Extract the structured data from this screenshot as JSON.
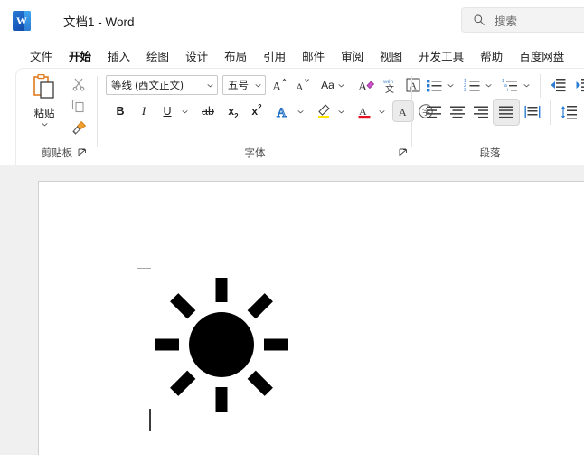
{
  "titlebar": {
    "app_icon": "word-icon",
    "document_title": "文档1  -  Word",
    "search": {
      "placeholder": "搜索",
      "icon": "search-icon"
    }
  },
  "tabs": [
    {
      "id": "file",
      "label": "文件",
      "active": false
    },
    {
      "id": "home",
      "label": "开始",
      "active": true
    },
    {
      "id": "insert",
      "label": "插入",
      "active": false
    },
    {
      "id": "draw",
      "label": "绘图",
      "active": false
    },
    {
      "id": "design",
      "label": "设计",
      "active": false
    },
    {
      "id": "layout",
      "label": "布局",
      "active": false
    },
    {
      "id": "references",
      "label": "引用",
      "active": false
    },
    {
      "id": "mailings",
      "label": "邮件",
      "active": false
    },
    {
      "id": "review",
      "label": "审阅",
      "active": false
    },
    {
      "id": "view",
      "label": "视图",
      "active": false
    },
    {
      "id": "developer",
      "label": "开发工具",
      "active": false
    },
    {
      "id": "help",
      "label": "帮助",
      "active": false
    },
    {
      "id": "baidu",
      "label": "百度网盘",
      "active": false
    }
  ],
  "ribbon": {
    "clipboard": {
      "label": "剪贴板",
      "paste_label": "粘贴",
      "paste_icon": "paste-clipboard-icon",
      "cut_icon": "scissors-icon",
      "copy_icon": "copy-icon",
      "format_painter_icon": "format-painter-icon",
      "dialog_launcher_icon": "dialog-launcher-icon"
    },
    "font": {
      "label": "字体",
      "font_name": "等线 (西文正文)",
      "font_size": "五号",
      "grow_font_icon": "grow-font-icon",
      "shrink_font_icon": "shrink-font-icon",
      "change_case_label": "Aa",
      "clear_formatting_icon": "clear-formatting-icon",
      "phonetic_guide_icon": "phonetic-guide-icon",
      "character_border_icon": "character-border-icon",
      "bold_label": "B",
      "italic_label": "I",
      "underline_label": "U",
      "strikethrough_label": "ab",
      "subscript_label": "x",
      "subscript_sub": "2",
      "superscript_label": "x",
      "superscript_sup": "2",
      "text_effects_icon": "text-effects-icon",
      "highlight_icon": "text-highlight-icon",
      "highlight_color": "#ffe400",
      "font_color_icon": "font-color-icon",
      "font_color": "#e81123",
      "character_shading_icon": "character-shading-icon",
      "enclose_characters_icon": "enclose-characters-icon",
      "dialog_launcher_icon": "dialog-launcher-icon"
    },
    "paragraph": {
      "label": "段落",
      "bullets_icon": "bullet-list-icon",
      "numbering_icon": "numbered-list-icon",
      "multilevel_icon": "multilevel-list-icon",
      "decrease_indent_icon": "decrease-indent-icon",
      "increase_indent_icon": "increase-indent-icon",
      "align_left_icon": "align-left-icon",
      "align_center_icon": "align-center-icon",
      "align_right_icon": "align-right-icon",
      "justify_icon": "justify-icon",
      "distribute_icon": "distribute-icon",
      "line_spacing_icon": "line-spacing-icon",
      "active_alignment": "justify"
    },
    "accent_color": "#2b579a"
  },
  "document": {
    "content_icon": "sun-icon",
    "sun_color": "#000000",
    "sun_rays": 8,
    "caret_visible": true,
    "page_background": "#ffffff",
    "workspace_background": "#f0f0f0"
  }
}
